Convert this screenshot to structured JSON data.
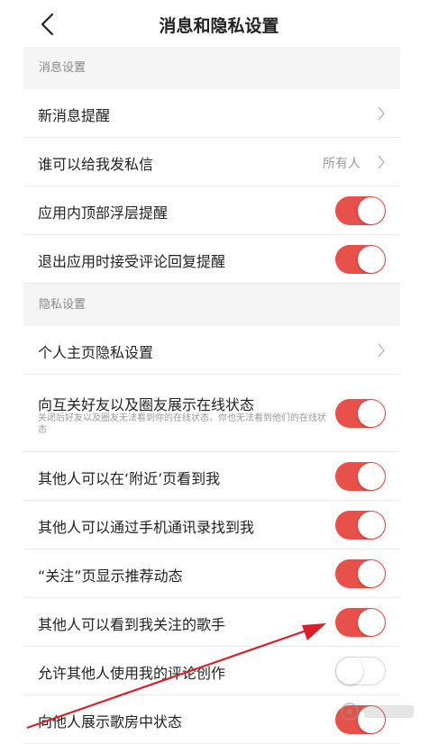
{
  "header": {
    "title": "消息和隐私设置",
    "back_icon": "chevron-left-icon"
  },
  "sections": [
    {
      "title": "消息设置",
      "items": [
        {
          "label": "新消息提醒",
          "control": "chevron"
        },
        {
          "label": "谁可以给我发私信",
          "value": "所有人",
          "control": "chevron"
        },
        {
          "label": "应用内顶部浮层提醒",
          "control": "toggle",
          "enabled": true
        },
        {
          "label": "退出应用时接受评论回复提醒",
          "control": "toggle",
          "enabled": true
        }
      ]
    },
    {
      "title": "隐私设置",
      "items": [
        {
          "label": "个人主页隐私设置",
          "control": "chevron"
        },
        {
          "label": "向互关好友以及圈友展示在线状态",
          "subtitle": "关闭后好友以及圈友无法看到你的在线状态，你也无法看到他们的在线状态",
          "control": "toggle",
          "enabled": true
        },
        {
          "label": "其他人可以在‘附近’页看到我",
          "control": "toggle",
          "enabled": true
        },
        {
          "label": "其他人可以通过手机通讯录找到我",
          "control": "toggle",
          "enabled": true
        },
        {
          "label": "“关注”页显示推荐动态",
          "control": "toggle",
          "enabled": true
        },
        {
          "label": "其他人可以看到我关注的歌手",
          "control": "toggle",
          "enabled": true
        },
        {
          "label": "允许其他人使用我的评论创作",
          "control": "toggle",
          "enabled": false
        },
        {
          "label": "向他人展示歌房中状态",
          "control": "toggle",
          "enabled": true
        }
      ]
    }
  ],
  "colors": {
    "toggle_on": "#e8504a",
    "annotation_arrow": "#d9202a",
    "section_bg": "#f5f5f5"
  }
}
